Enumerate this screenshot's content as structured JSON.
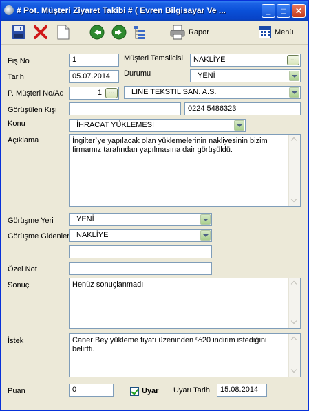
{
  "window": {
    "title": "# Pot. Müşteri Ziyaret Takibi #  ( Evren Bilgisayar Ve ...",
    "controls": {
      "minimize": "_",
      "maximize": "□",
      "close": "✕"
    }
  },
  "toolbar": {
    "rapor_label": "Rapor",
    "menu_label": "Menü"
  },
  "form": {
    "fis_no": {
      "label": "Fiş No",
      "value": "1"
    },
    "tarih": {
      "label": "Tarih",
      "value": "05.07.2014"
    },
    "musteri_temsilcisi": {
      "label": "Müşteri Temsilcisi",
      "value": "NAKLİYE"
    },
    "durumu": {
      "label": "Durumu",
      "value": "YENİ"
    },
    "pot_musteri": {
      "label": "P. Müşteri No/Ad",
      "no": "1",
      "name": "LINE TEKSTIL SAN. A.S."
    },
    "gorusulen_kisi": {
      "label": "Görüşülen Kişi",
      "value": "",
      "phone": "0224 5486323"
    },
    "konu": {
      "label": "Konu",
      "value": "İHRACAT YÜKLEMESİ"
    },
    "aciklama": {
      "label": "Açıklama",
      "value": "İngilter`ye yapılacak olan yüklemelerinin nakliyesinin bizim firmamız tarafından yapılmasına dair görüşüldü."
    },
    "gorusme_yeri": {
      "label": "Görüşme Yeri",
      "value": "YENİ"
    },
    "gorusme_gidenler": {
      "label": "Görüşme Gidenler",
      "value": "NAKLİYE",
      "extra": ""
    },
    "ozel_not": {
      "label": "Özel Not",
      "value": ""
    },
    "sonuc": {
      "label": "Sonuç",
      "value": "Henüz sonuçlanmadı"
    },
    "istek": {
      "label": "İstek",
      "value": "Caner Bey yükleme fiyatı üzeninden %20 indirim istediğini belirtti."
    },
    "puan": {
      "label": "Puan",
      "value": "0"
    },
    "uyar": {
      "label": "Uyar",
      "checked": true
    },
    "uyari_tarih": {
      "label": "Uyarı Tarih",
      "value": "15.08.2014"
    }
  },
  "colors": {
    "titlebar": "#0a50d8",
    "window_bg": "#ece9d8",
    "input_border": "#7f9db9"
  }
}
